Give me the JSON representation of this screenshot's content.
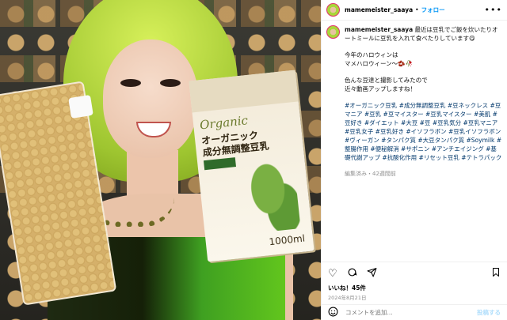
{
  "media": {
    "carton_brand": "Organic",
    "carton_title_line1": "オーガニック",
    "carton_title_line2": "成分無調整豆乳",
    "carton_volume": "1000ml"
  },
  "header": {
    "username": "mamemeister_saaya",
    "separator": "•",
    "follow_label": "フォロー",
    "more_icon": "•••"
  },
  "caption": {
    "username": "mamemeister_saaya",
    "line1": "最近は豆乳でご飯を炊いたりオートミールに豆乳を入れて食べたりしています😋",
    "para2": "今年のハロウィンは\nマメハロウィーン～🫘🥀",
    "para3": "色んな豆達と撮影してみたので\n近々動画アップしますね！",
    "hashtags": "#オーガニック豆乳 #成分無調整豆乳 #豆ネックレス #豆マニア #豆乳 #豆マイスター #豆乳マイスター #美肌 #豆好き #ダイエット #大豆 #豆 #豆乳気分 #豆乳マニア #豆乳女子 #豆乳好き #イソフラボン #豆乳イソフラボン #ヴィーガン #タンパク質 #大豆タンパク質 #Soymilk #整腸作用 #便秘解消 #サポニン #アンチエイジング #基礎代謝アップ #抗酸化作用 #リセット豆乳 #テトラパック",
    "edited": "編集済み・42週間前"
  },
  "actions": {
    "like_icon": "heart-icon",
    "comment_icon": "comment-icon",
    "share_icon": "share-icon",
    "save_icon": "bookmark-icon"
  },
  "likes": "いいね！45件",
  "date": "2024年8月21日",
  "comment_box": {
    "placeholder": "コメントを追加...",
    "post_label": "投稿する"
  }
}
